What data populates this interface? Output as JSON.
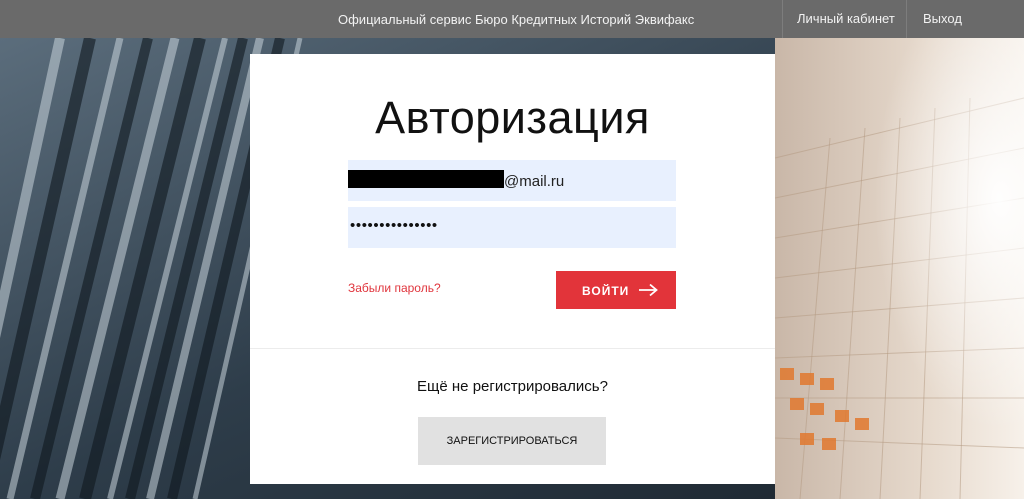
{
  "header": {
    "service_text": "Официальный сервис Бюро Кредитных Историй Эквифакс",
    "nav": {
      "cabinet": "Личный кабинет",
      "logout": "Выход"
    }
  },
  "auth": {
    "title": "Авторизация",
    "login_field": {
      "value_suffix": "@mail.ru",
      "redacted": true
    },
    "password_field": {
      "masked_value": "•••••••••••••••"
    },
    "forgot_link": "Забыли пароль?",
    "login_button": "ВОЙТИ",
    "register_prompt": "Ещё не регистрировались?",
    "register_button": "ЗАРЕГИСТРИРОВАТЬСЯ"
  },
  "colors": {
    "accent": "#e2343a",
    "topbar": "#6a6a6a",
    "input_bg": "#e8f0fe",
    "register_button_bg": "#e1e1e1"
  },
  "icons": {
    "login_arrow": "arrow-right-icon"
  }
}
